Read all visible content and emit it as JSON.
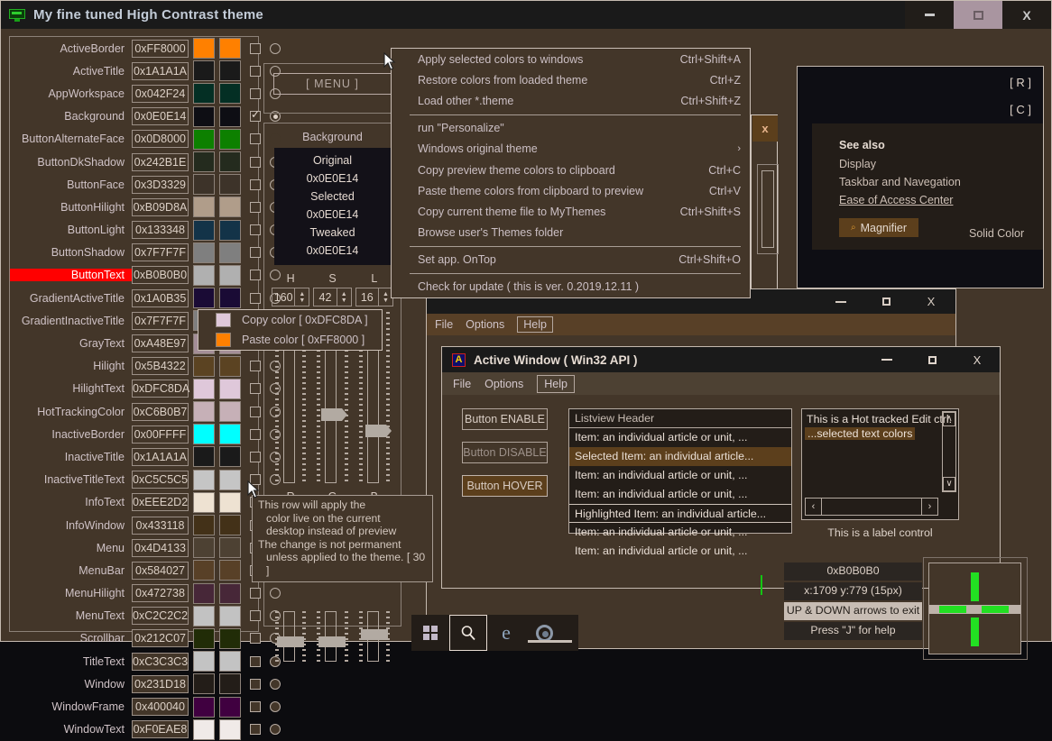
{
  "window": {
    "title": "My fine tuned High Contrast theme",
    "icon": "monitor-icon",
    "minimize": "—",
    "restore": "▢",
    "close": "X"
  },
  "color_table": {
    "rows": [
      {
        "name": "ActiveBorder",
        "value": "0xFF8000",
        "swatch": "#ff8000",
        "checked": false,
        "radio": false
      },
      {
        "name": "ActiveTitle",
        "value": "0x1A1A1A",
        "swatch": "#1a1a1a",
        "checked": false,
        "radio": false
      },
      {
        "name": "AppWorkspace",
        "value": "0x042F24",
        "swatch": "#042f24",
        "checked": false,
        "radio": false
      },
      {
        "name": "Background",
        "value": "0x0E0E14",
        "swatch": "#0e0e14",
        "checked": true,
        "radio": true
      },
      {
        "name": "ButtonAlternateFace",
        "value": "0x0D8000",
        "swatch": "#0d8000",
        "checked": false,
        "radio": null
      },
      {
        "name": "ButtonDkShadow",
        "value": "0x242B1E",
        "swatch": "#242b1e",
        "checked": false,
        "radio": false
      },
      {
        "name": "ButtonFace",
        "value": "0x3D3329",
        "swatch": "#3d3329",
        "checked": false,
        "radio": false
      },
      {
        "name": "ButtonHilight",
        "value": "0xB09D8A",
        "swatch": "#b09d8a",
        "checked": false,
        "radio": false
      },
      {
        "name": "ButtonLight",
        "value": "0x133348",
        "swatch": "#133348",
        "checked": false,
        "radio": false
      },
      {
        "name": "ButtonShadow",
        "value": "0x7F7F7F",
        "swatch": "#7f7f7f",
        "checked": false,
        "radio": false
      },
      {
        "name": "ButtonText",
        "value": "0xB0B0B0",
        "swatch": "#b0b0b0",
        "checked": false,
        "radio": false,
        "selected": true
      },
      {
        "name": "GradientActiveTitle",
        "value": "0x1A0B35",
        "swatch": "#1a0b35",
        "checked": false,
        "radio": false
      },
      {
        "name": "GradientInactiveTitle",
        "value": "0x7F7F7F",
        "swatch": "#7f7f7f",
        "checked": false,
        "radio": false
      },
      {
        "name": "GrayText",
        "value": "0xA48E97",
        "swatch": "#a48e97",
        "checked": false,
        "radio": false
      },
      {
        "name": "Hilight",
        "value": "0x5B4322",
        "swatch": "#5b4322",
        "checked": false,
        "radio": false
      },
      {
        "name": "HilightText",
        "value": "0xDFC8DA",
        "swatch": "#dfc8da",
        "checked": false,
        "radio": false
      },
      {
        "name": "HotTrackingColor",
        "value": "0xC6B0B7",
        "swatch": "#c6b0b7",
        "checked": false,
        "radio": false
      },
      {
        "name": "InactiveBorder",
        "value": "0x00FFFF",
        "swatch": "#00ffff",
        "checked": false,
        "radio": false
      },
      {
        "name": "InactiveTitle",
        "value": "0x1A1A1A",
        "swatch": "#1a1a1a",
        "checked": false,
        "radio": false
      },
      {
        "name": "InactiveTitleText",
        "value": "0xC5C5C5",
        "swatch": "#c5c5c5",
        "checked": false,
        "radio": false
      },
      {
        "name": "InfoText",
        "value": "0xEEE2D2",
        "swatch": "#eee2d2",
        "checked": false,
        "radio": false
      },
      {
        "name": "InfoWindow",
        "value": "0x433118",
        "swatch": "#433118",
        "checked": false,
        "radio": false
      },
      {
        "name": "Menu",
        "value": "0x4D4133",
        "swatch": "#4d4133",
        "checked": false,
        "radio": false
      },
      {
        "name": "MenuBar",
        "value": "0x584027",
        "swatch": "#584027",
        "checked": false,
        "radio": false
      },
      {
        "name": "MenuHilight",
        "value": "0x472738",
        "swatch": "#472738",
        "checked": false,
        "radio": false
      },
      {
        "name": "MenuText",
        "value": "0xC2C2C2",
        "swatch": "#c2c2c2",
        "checked": false,
        "radio": false
      },
      {
        "name": "Scrollbar",
        "value": "0x212C07",
        "swatch": "#212c07",
        "checked": false,
        "radio": false
      },
      {
        "name": "TitleText",
        "value": "0xC3C3C3",
        "swatch": "#c3c3c3",
        "checked": false,
        "radio": false
      },
      {
        "name": "Window",
        "value": "0x231D18",
        "swatch": "#231d18",
        "checked": false,
        "radio": false
      },
      {
        "name": "WindowFrame",
        "value": "0x400040",
        "swatch": "#400040",
        "checked": false,
        "radio": false
      },
      {
        "name": "WindowText",
        "value": "0xF0EAE8",
        "swatch": "#f0eae8",
        "checked": false,
        "radio": false
      }
    ]
  },
  "tweak": {
    "menu_button": "[ MENU ]",
    "name": "Background",
    "original_label": "Original",
    "original_value": "0x0E0E14",
    "selected_label": "Selected",
    "selected_value": "0x0E0E14",
    "tweaked_label": "Tweaked",
    "tweaked_value": "0x0E0E14",
    "hsl_labels": [
      "H",
      "S",
      "L"
    ],
    "hsl_values": [
      "160",
      "42",
      "16"
    ],
    "rgb_labels": [
      "R",
      "G",
      "B"
    ],
    "rgb_values": [
      "14",
      "14",
      "20"
    ]
  },
  "dropdown": {
    "items": [
      {
        "label": "Apply selected colors to windows",
        "accel": "Ctrl+Shift+A"
      },
      {
        "label": "Restore colors from loaded theme",
        "accel": "Ctrl+Z"
      },
      {
        "label": "Load other *.theme",
        "accel": "Ctrl+Shift+Z"
      },
      {
        "sep": true
      },
      {
        "label": "run \"Personalize\"",
        "accel": ""
      },
      {
        "label": "Windows original theme",
        "submenu": "›"
      },
      {
        "label": "Copy preview theme colors to clipboard",
        "accel": "Ctrl+C"
      },
      {
        "label": "Paste theme colors from clipboard to preview",
        "accel": "Ctrl+V"
      },
      {
        "label": "Copy current theme file to MyThemes",
        "accel": "Ctrl+Shift+S"
      },
      {
        "label": "Browse user's Themes folder",
        "accel": ""
      },
      {
        "sep": true
      },
      {
        "label": "Set app. OnTop",
        "accel": "Ctrl+Shift+O"
      },
      {
        "sep": true
      },
      {
        "label": "Check for update   ( this is ver. 0.2019.12.11 )",
        "accel": ""
      }
    ]
  },
  "context_menu": {
    "copy_label": "Copy color  [ 0xDFC8DA ]",
    "copy_swatch": "#dfc8da",
    "paste_label": "Paste color  [ 0xFF8000 ]",
    "paste_swatch": "#ff8000"
  },
  "tooltip": {
    "lines": [
      "This row will apply the",
      "color live on the current",
      "desktop instead of preview",
      "The change is not permanent",
      "unless applied to the theme.  [ 30 ]"
    ]
  },
  "ease_of_access": {
    "r_badge": "[ R ]",
    "c_badge": "[ C ]",
    "see_also": "See also",
    "links": [
      "Display",
      "Taskbar and Navegation",
      "Ease of Access Center"
    ],
    "magnifier_button": "Magnifier",
    "magnifier_icon": "magnifier-icon",
    "solid_color": "Solid Color"
  },
  "behind_window": {
    "close": "x"
  },
  "preview_window": {
    "menu": [
      "File",
      "Options",
      "Help"
    ],
    "minimize": "—",
    "restore": "▢",
    "close": "X"
  },
  "active_window": {
    "title": "Active Window ( Win32 API )",
    "icon_letter": "A",
    "minimize": "—",
    "restore": "▢",
    "close": "X",
    "menu": [
      "File",
      "Options",
      "Help"
    ],
    "buttons": [
      "Button ENABLE",
      "Button DISABLE",
      "Button HOVER"
    ],
    "listview": {
      "header": "Listview Header",
      "items": [
        {
          "text": "Item: an individual article or unit, ...",
          "state": "normal"
        },
        {
          "text": "Selected Item: an individual article...",
          "state": "selected"
        },
        {
          "text": "Item: an individual article or unit, ...",
          "state": "normal"
        },
        {
          "text": "Item: an individual article or unit, ...",
          "state": "normal"
        },
        {
          "text": "Highlighted Item: an individual article...",
          "state": "hilite"
        },
        {
          "text": "Item: an individual article or unit, ...",
          "state": "normal"
        },
        {
          "text": "Item: an individual article or unit, ...",
          "state": "normal"
        }
      ]
    },
    "edit_ctrl": {
      "line1": "This is a Hot tracked Edit ctrl.",
      "line2": "...selected text colors",
      "scroll_up": "∧",
      "scroll_down": "∨",
      "scroll_left": "‹",
      "scroll_right": "›"
    },
    "label_ctrl": "This is a label control"
  },
  "taskbar": {
    "start_icon": "windows-logo-icon",
    "search_icon": "search-icon",
    "edge_icon": "edge-browser-icon",
    "chrome_icon": "chrome-browser-icon"
  },
  "readout": {
    "color": "0xB0B0B0",
    "coords": "x:1709  y:779  (15px)",
    "hint_exit": "UP & DOWN arrows to exit",
    "hint_help": "Press \"J\" for help"
  },
  "colors": {
    "accent_orange": "#ff8000",
    "panel_bg": "#433629",
    "window_bg": "#231d18",
    "title_bg": "#1a1a1a",
    "text": "#cfc2c6",
    "selected_row": "#ff0000",
    "highlight": "#5b4322",
    "magnifier_green": "#22e022"
  }
}
